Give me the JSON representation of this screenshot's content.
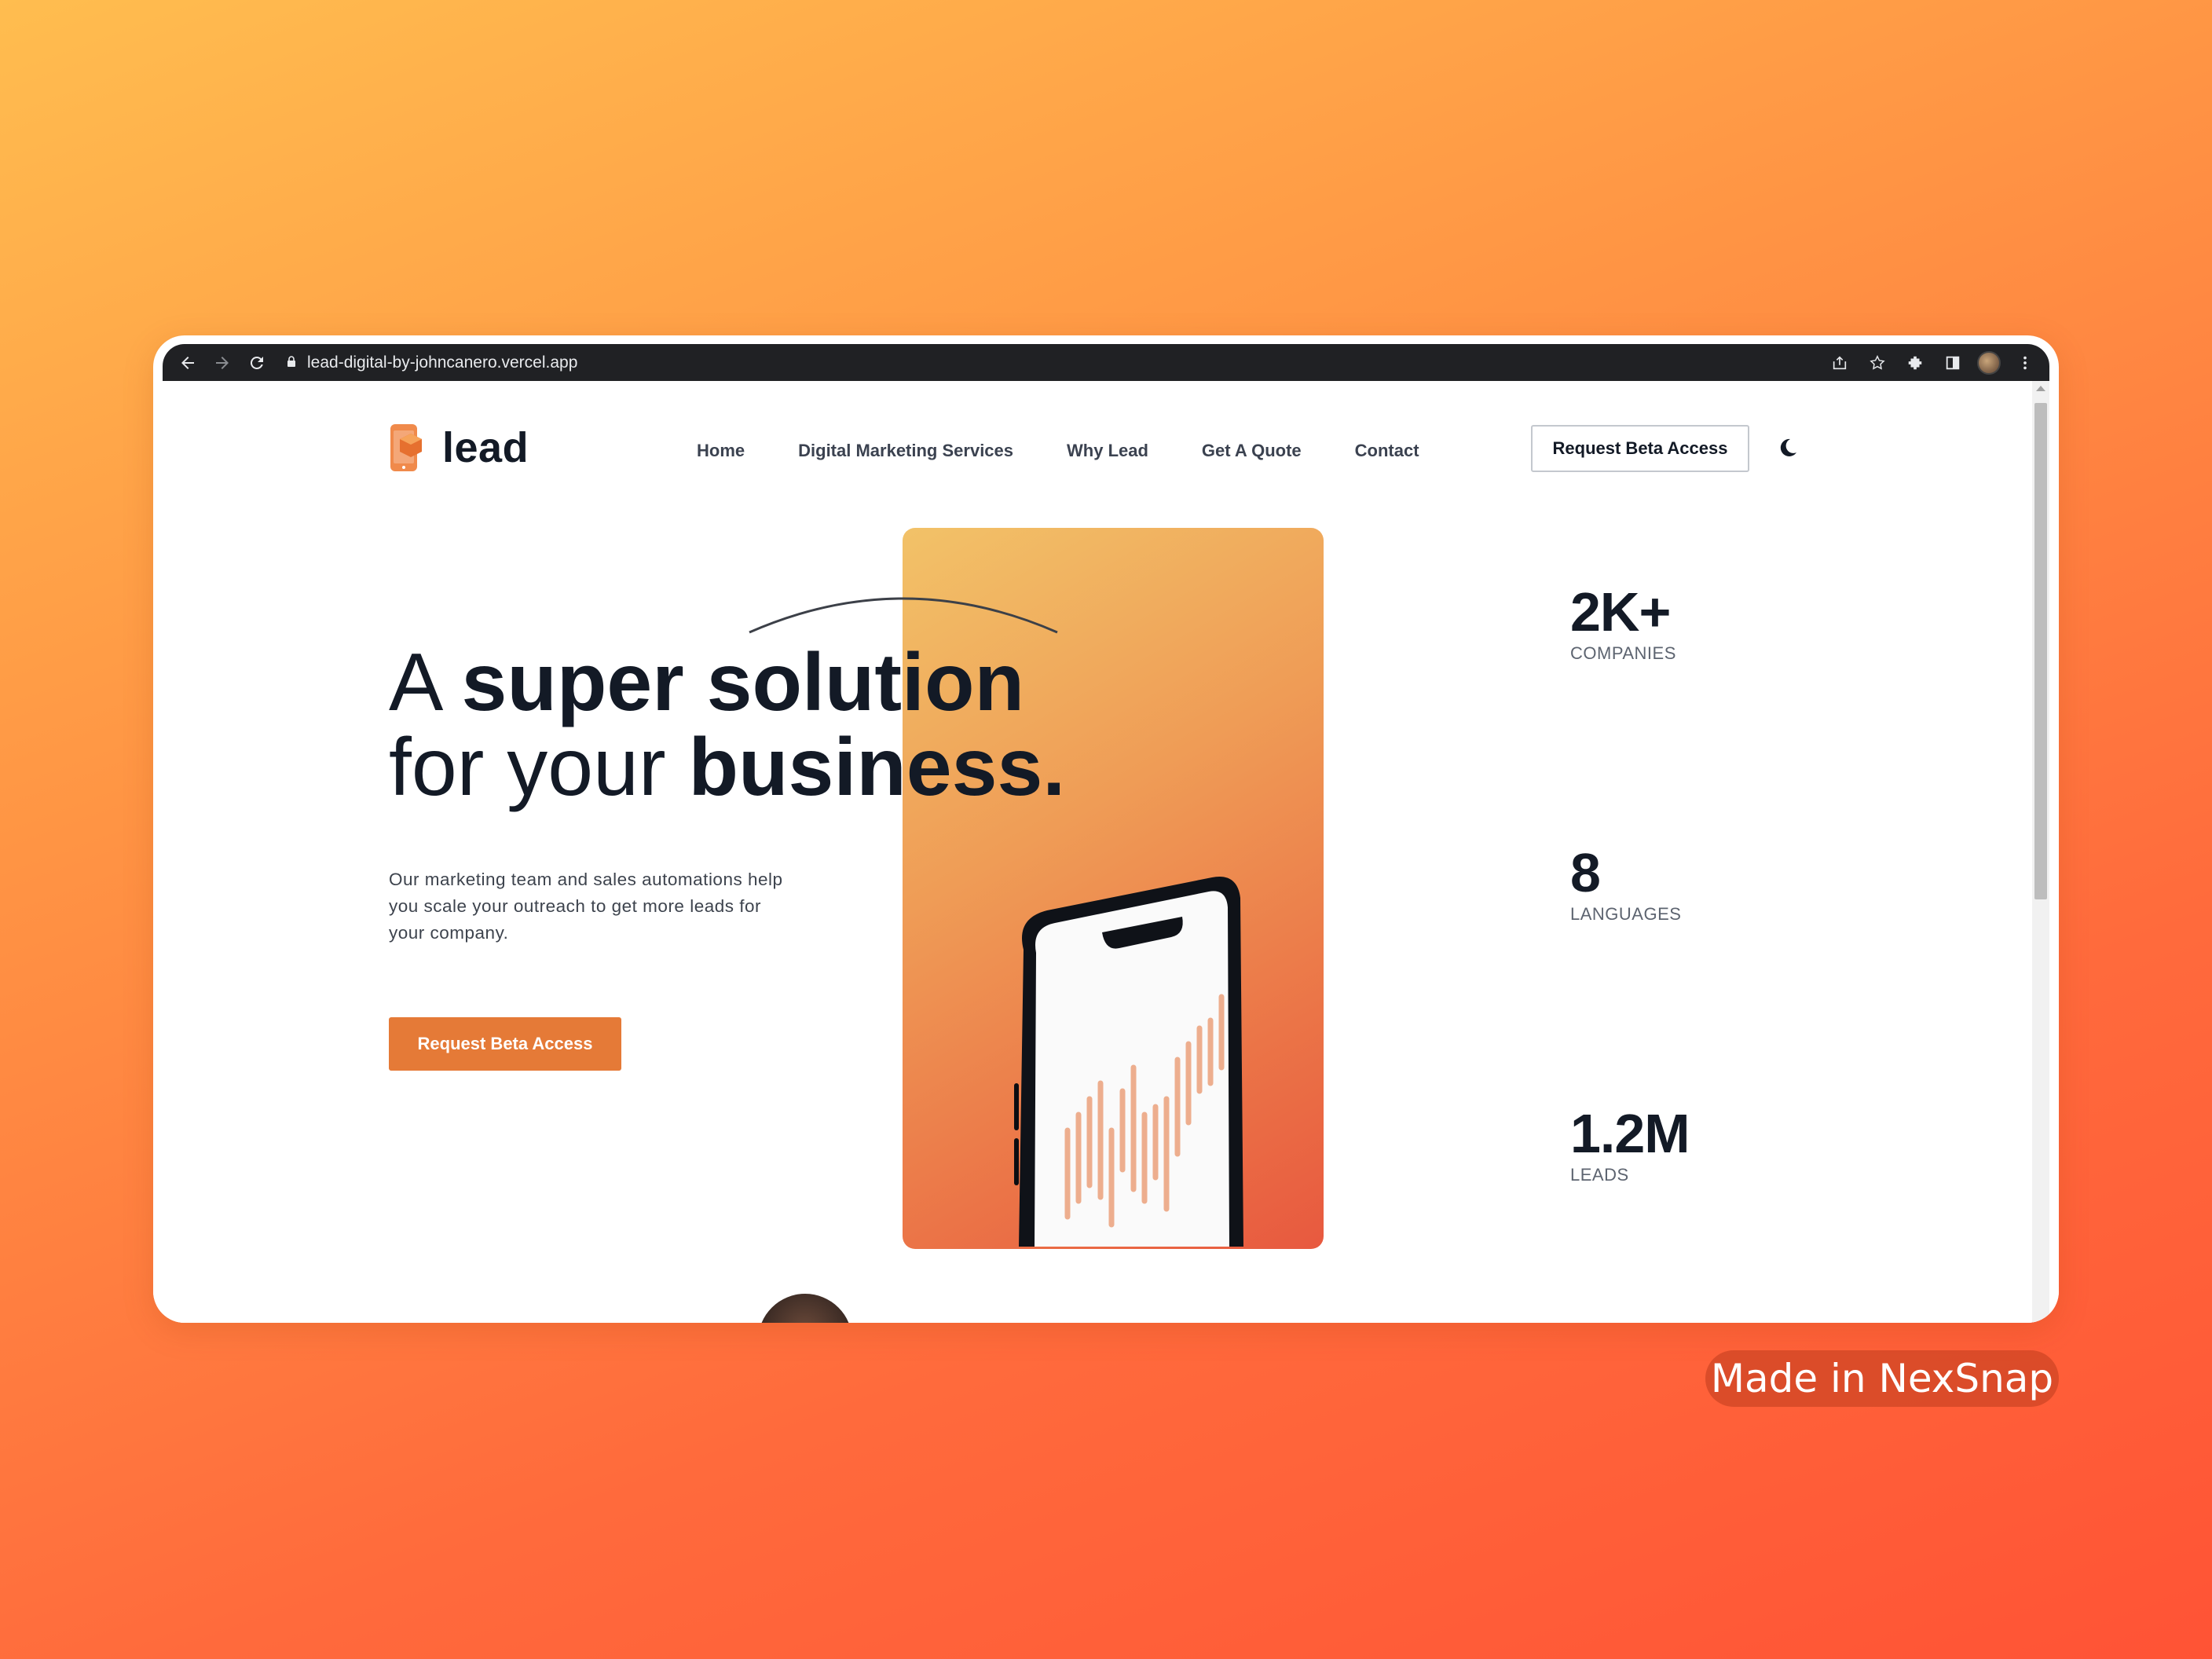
{
  "browser": {
    "url": "lead-digital-by-johncanero.vercel.app",
    "icons": [
      "back-icon",
      "forward-icon",
      "reload-icon",
      "lock-icon",
      "share-icon",
      "star-icon",
      "extensions-icon",
      "side-panel-icon",
      "profile-avatar",
      "more-icon"
    ]
  },
  "site": {
    "logo_text": "lead",
    "nav": [
      "Home",
      "Digital Marketing Services",
      "Why Lead",
      "Get A Quote",
      "Contact"
    ],
    "header_cta": "Request Beta Access",
    "theme_toggle_icon": "moon-icon"
  },
  "hero": {
    "line1_light": "A ",
    "line1_bold": "super solution",
    "line2_light": "for your ",
    "line2_bold": "business.",
    "subtext": "Our marketing team and sales automations help you scale your outreach to get more leads for your company.",
    "cta": "Request Beta Access"
  },
  "stats": [
    {
      "value": "2K+",
      "label": "COMPANIES"
    },
    {
      "value": "8",
      "label": "LANGUAGES"
    },
    {
      "value": "1.2M",
      "label": "LEADS"
    }
  ],
  "watermark": "Made in NexSnap",
  "colors": {
    "accent": "#e57a37",
    "dark_text": "#131a26",
    "card_gradient_start": "#f2c268",
    "card_gradient_end": "#e8593f"
  }
}
